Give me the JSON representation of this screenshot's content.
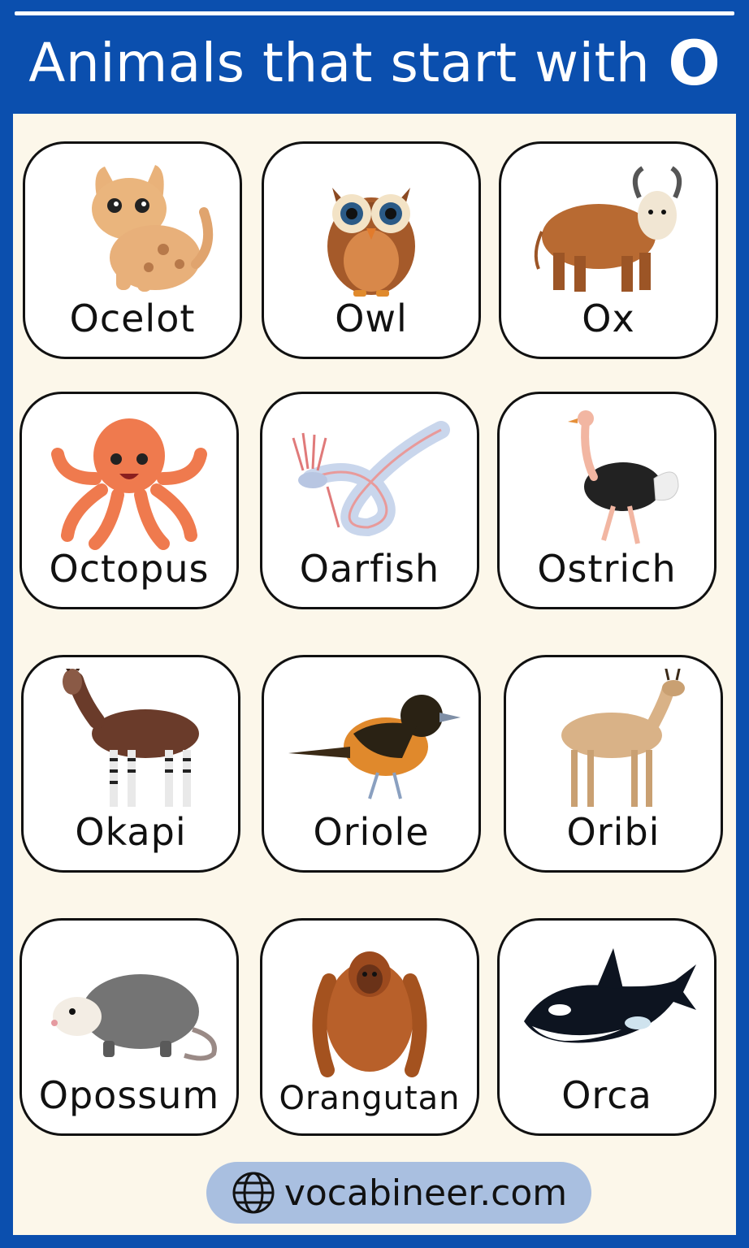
{
  "header": {
    "title": "Animals that start with",
    "letter": "O"
  },
  "cards": [
    {
      "label": "Ocelot",
      "icon": "ocelot-icon"
    },
    {
      "label": "Owl",
      "icon": "owl-icon"
    },
    {
      "label": "Ox",
      "icon": "ox-icon"
    },
    {
      "label": "Octopus",
      "icon": "octopus-icon"
    },
    {
      "label": "Oarfish",
      "icon": "oarfish-icon"
    },
    {
      "label": "Ostrich",
      "icon": "ostrich-icon"
    },
    {
      "label": "Okapi",
      "icon": "okapi-icon"
    },
    {
      "label": "Oriole",
      "icon": "oriole-icon"
    },
    {
      "label": "Oribi",
      "icon": "oribi-icon"
    },
    {
      "label": "Opossum",
      "icon": "opossum-icon"
    },
    {
      "label": "Orangutan",
      "icon": "orangutan-icon"
    },
    {
      "label": "Orca",
      "icon": "orca-icon"
    }
  ],
  "footer": {
    "site": "vocabineer.com",
    "icon": "globe-icon"
  },
  "colors": {
    "brand_blue": "#0b4fae",
    "panel_cream": "#fcf7ea",
    "pill_blue": "#a9bfe0"
  }
}
